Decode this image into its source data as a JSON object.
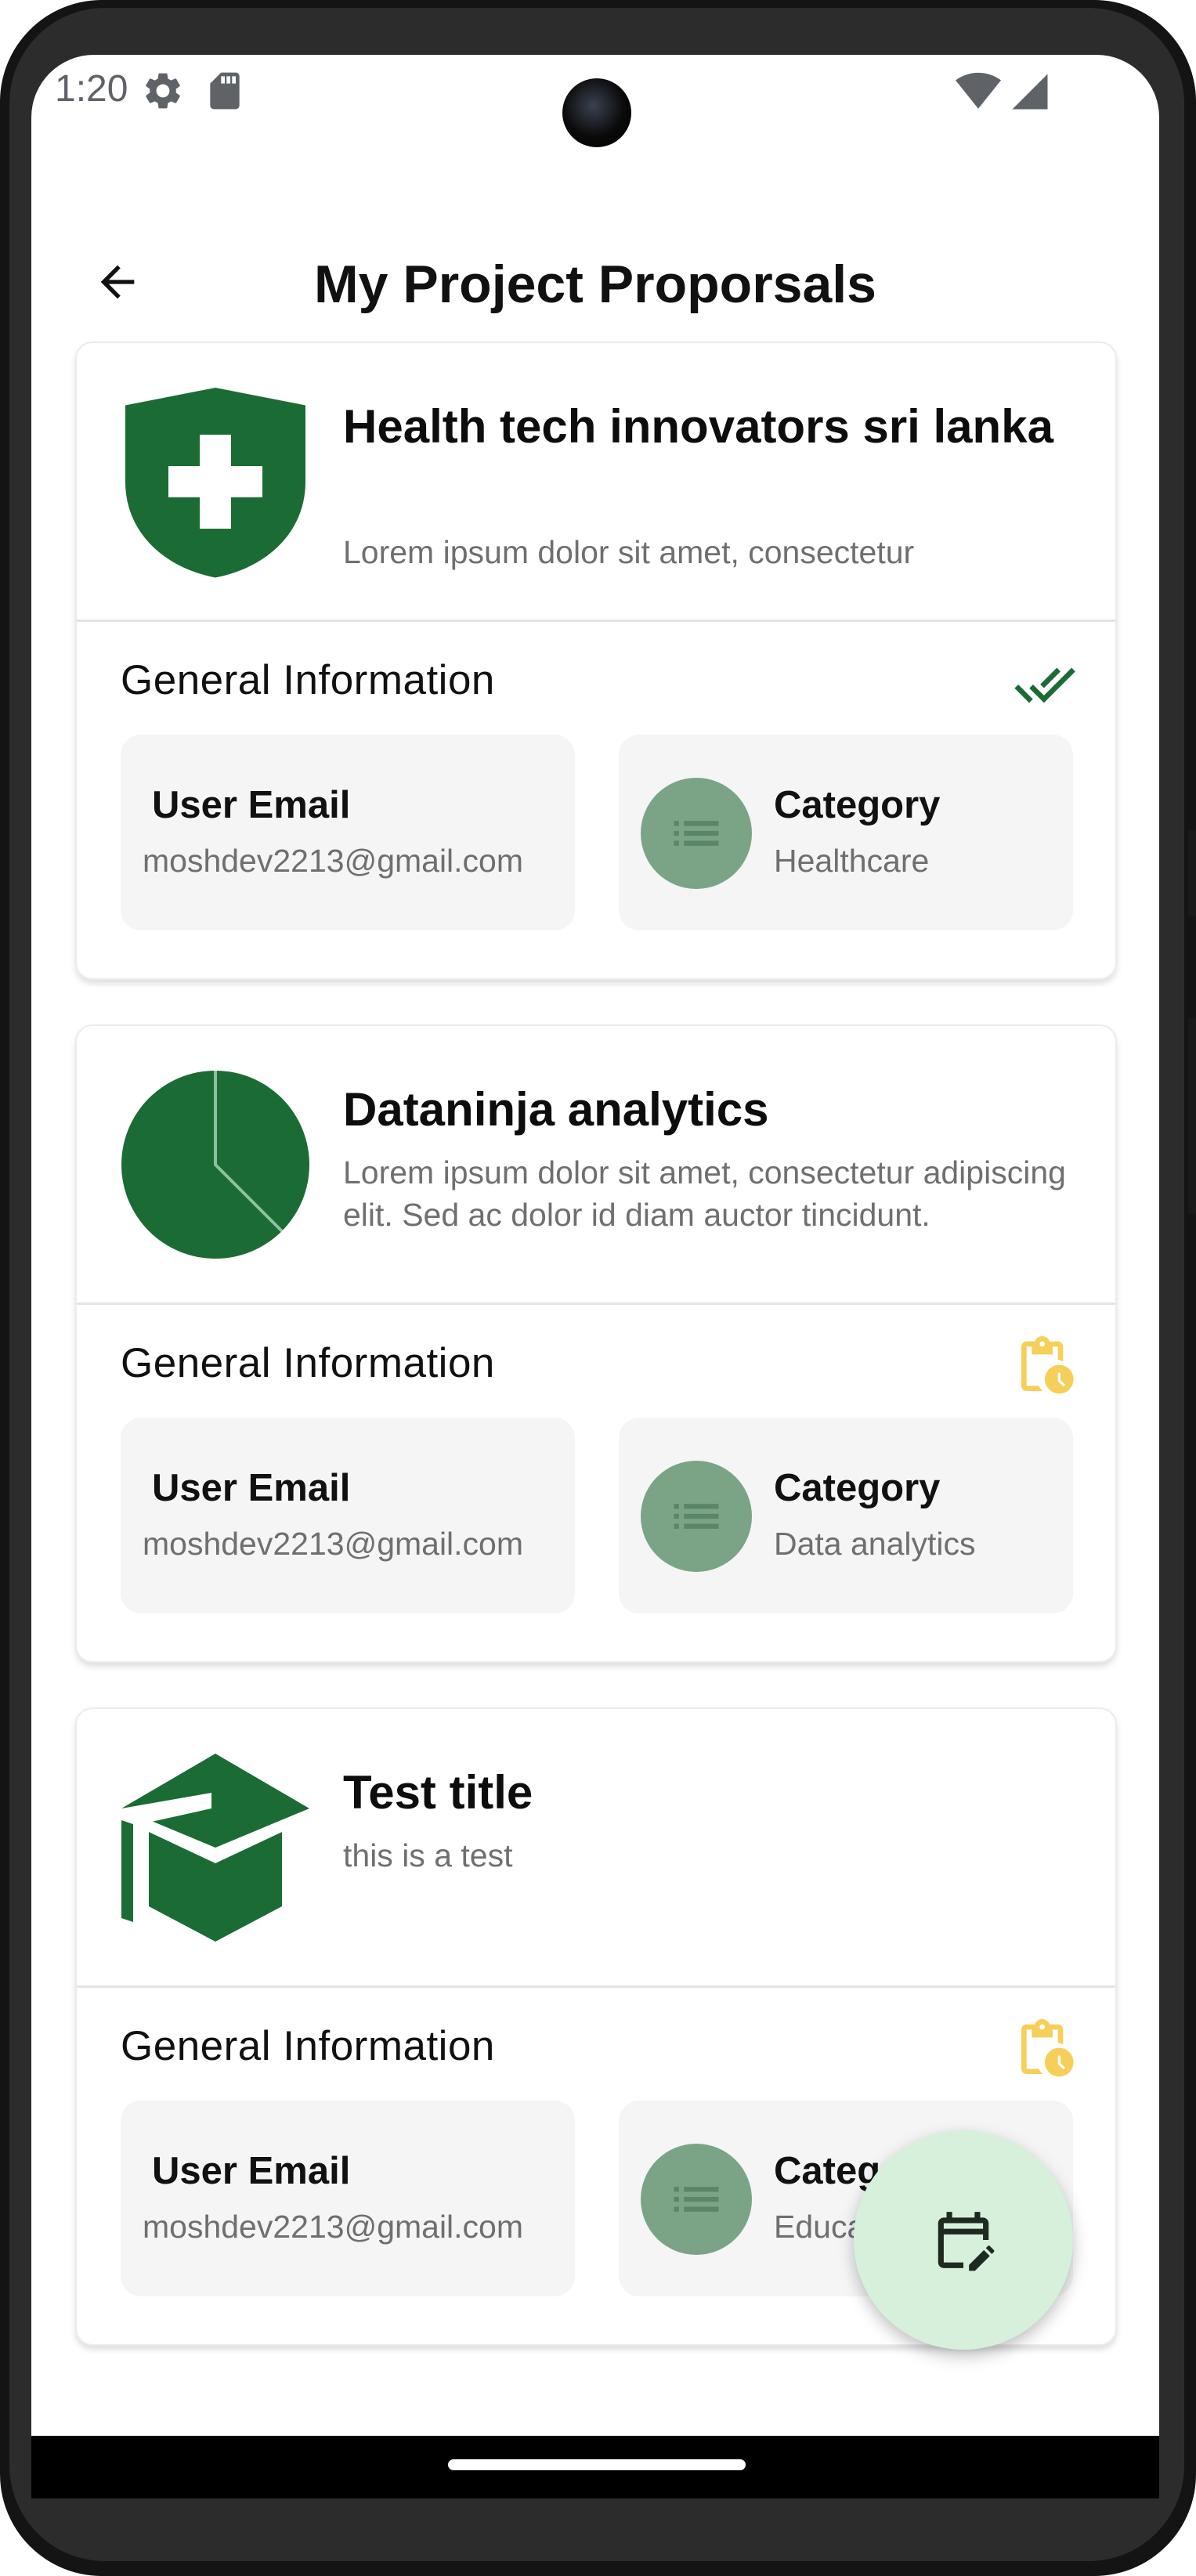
{
  "status_bar": {
    "time": "1:20",
    "icons": [
      "settings-gear-icon",
      "sd-card-icon",
      "wifi-icon",
      "cellular-signal-icon"
    ]
  },
  "app_bar": {
    "back_icon": "arrow-back-icon",
    "title": "My Project Proporsals"
  },
  "colors": {
    "brand_green": "#1b6b35",
    "approved_check": "#1b6b35",
    "pending_yellow": "#f6cf5a",
    "category_circle": "#7ba487",
    "fab_background": "#d7f0dc"
  },
  "proposals": [
    {
      "logo_icon": "medical-shield-icon",
      "title": "Health tech innovators sri lanka",
      "description": "Lorem ipsum dolor sit amet, consectetur",
      "section_title": "General Information",
      "status_icon": "double-check-icon",
      "status": "approved",
      "email_label": "User Email",
      "email_value": "moshdev2213@gmail.com",
      "category_icon": "list-icon",
      "category_label": "Category",
      "category_value": "Healthcare"
    },
    {
      "logo_icon": "pie-chart-icon",
      "title": "Dataninja analytics",
      "description": "Lorem ipsum dolor sit amet, consectetur adipiscing elit. Sed ac dolor id diam auctor tincidunt.",
      "section_title": "General Information",
      "status_icon": "clipboard-pending-icon",
      "status": "pending",
      "email_label": "User Email",
      "email_value": "moshdev2213@gmail.com",
      "category_icon": "list-icon",
      "category_label": "Category",
      "category_value": "Data analytics"
    },
    {
      "logo_icon": "graduation-cap-icon",
      "title": "Test title",
      "description": "this is a test",
      "section_title": "General Information",
      "status_icon": "clipboard-pending-icon",
      "status": "pending",
      "email_label": "User Email",
      "email_value": "moshdev2213@gmail.com",
      "category_icon": "list-icon",
      "category_label": "Category",
      "category_value": "Education"
    }
  ],
  "fab": {
    "icon": "edit-calendar-icon"
  }
}
